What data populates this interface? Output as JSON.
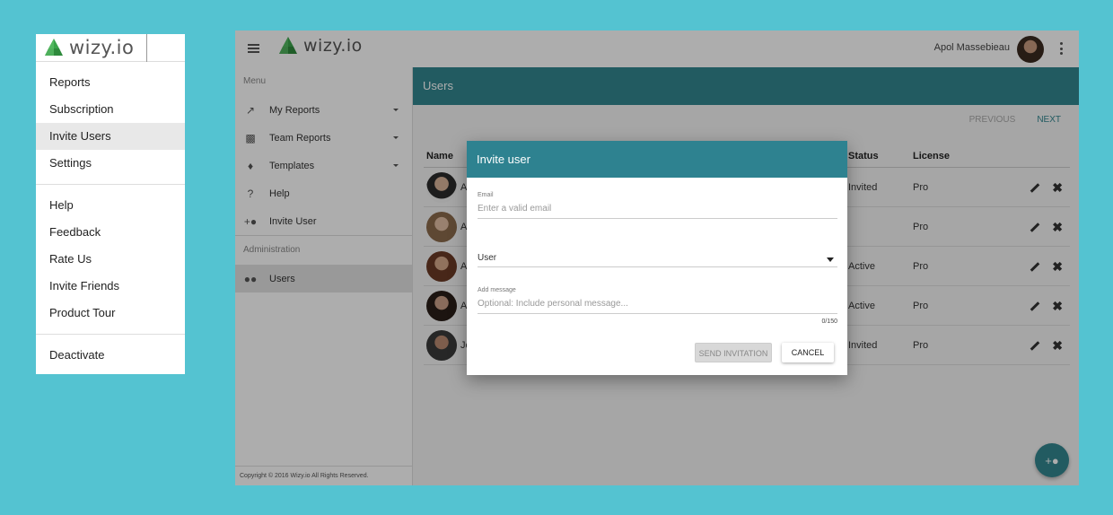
{
  "menu": {
    "brand": "wizy.io",
    "groups": [
      [
        "Reports",
        "Subscription",
        "Invite Users",
        "Settings"
      ],
      [
        "Help",
        "Feedback",
        "Rate Us",
        "Invite Friends",
        "Product Tour"
      ],
      [
        "Deactivate"
      ]
    ],
    "active_item": "Invite Users"
  },
  "app": {
    "brand": "wizy.io",
    "user_name": "Apol Massebieau",
    "nav": {
      "menu_section": "Menu",
      "items": [
        {
          "label": "My Reports",
          "icon": "trending-up-icon",
          "has_caret": true
        },
        {
          "label": "Team Reports",
          "icon": "bar-chart-icon",
          "has_caret": true
        },
        {
          "label": "Templates",
          "icon": "puzzle-icon",
          "has_caret": true
        },
        {
          "label": "Help",
          "icon": "help-icon",
          "has_caret": false
        },
        {
          "label": "Invite User",
          "icon": "add-user-icon",
          "has_caret": false
        }
      ],
      "admin_section": "Administration",
      "admin_items": [
        {
          "label": "Users",
          "icon": "group-icon",
          "active": true
        }
      ],
      "copyright": "Copyright © 2016 Wizy.io All Rights Reserved."
    },
    "page_title": "Users",
    "pager": {
      "previous": "PREVIOUS",
      "next": "NEXT"
    },
    "table": {
      "columns": {
        "name": "Name",
        "status": "Status",
        "license": "License"
      },
      "rows": [
        {
          "name": "A",
          "status": "Invited",
          "license": "Pro"
        },
        {
          "name": "A",
          "status": "",
          "license": "Pro"
        },
        {
          "name": "A",
          "status": "Active",
          "license": "Pro"
        },
        {
          "name": "A",
          "status": "Active",
          "license": "Pro"
        },
        {
          "name": "Jo",
          "status": "Invited",
          "license": "Pro"
        }
      ]
    }
  },
  "dialog": {
    "title": "Invite user",
    "email_label": "Email",
    "email_placeholder": "Enter a valid email",
    "role_value": "User",
    "message_label": "Add message",
    "message_placeholder": "Optional: Include personal message...",
    "counter": "0/150",
    "send_label": "SEND INVITATION",
    "cancel_label": "CANCEL"
  },
  "colors": {
    "background": "#54c3d1",
    "accent": "#338790",
    "dialog_header": "#2e8290"
  }
}
